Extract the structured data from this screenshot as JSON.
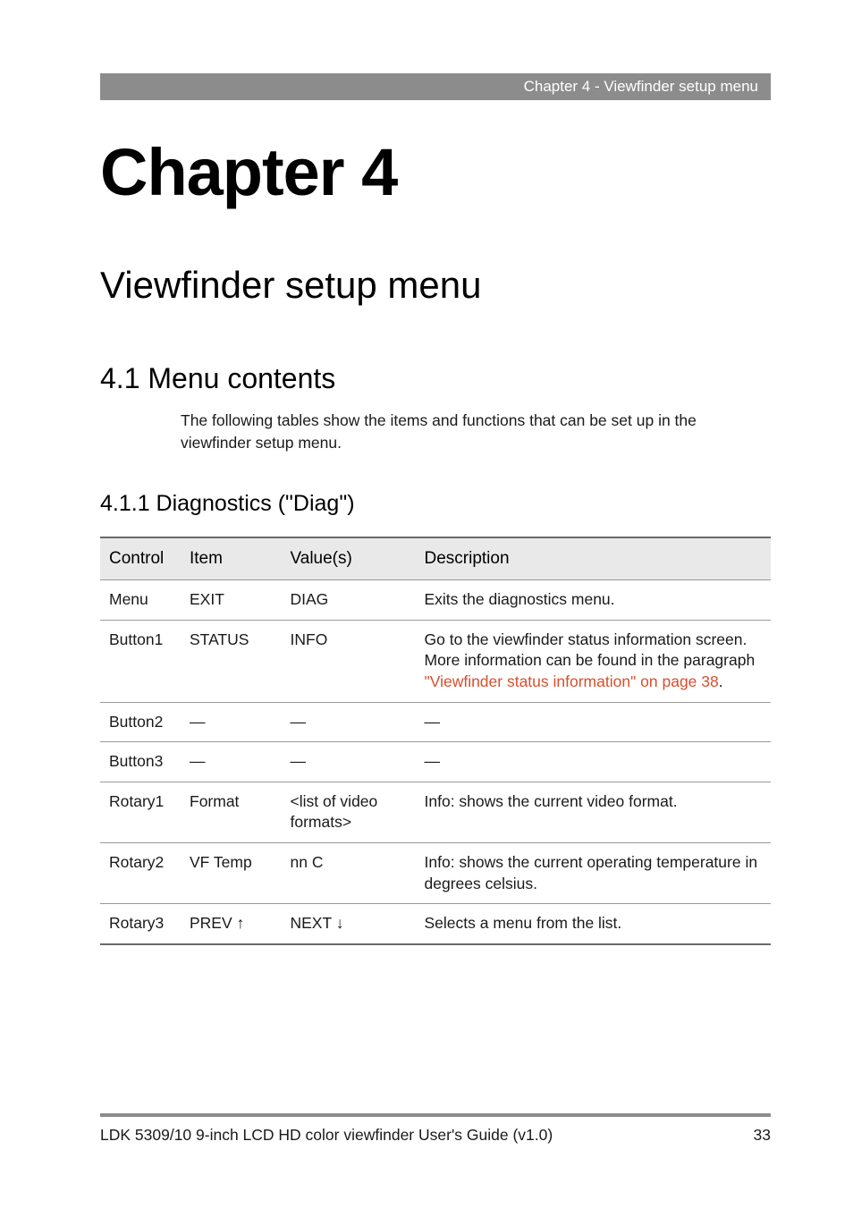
{
  "header": {
    "breadcrumb": "Chapter 4 - Viewfinder setup menu"
  },
  "titles": {
    "chapter": "Chapter 4",
    "section": "Viewfinder setup menu",
    "h2": "4.1  Menu contents",
    "h3": "4.1.1  Diagnostics (\"Diag\")"
  },
  "body": {
    "intro": "The following tables show the items and functions that can be set up in the viewfinder setup menu."
  },
  "table": {
    "headers": {
      "control": "Control",
      "item": "Item",
      "values": "Value(s)",
      "description": "Description"
    },
    "rows": [
      {
        "control": "Menu",
        "item": "EXIT",
        "values": "DIAG",
        "desc_pre": "Exits the diagnostics menu.",
        "xref": "",
        "desc_post": ""
      },
      {
        "control": "Button1",
        "item": "STATUS",
        "values": "INFO",
        "desc_pre": "Go to the viewfinder status information screen. More information can be found in the paragraph ",
        "xref": "\"Viewfinder status information\" on page 38",
        "desc_post": "."
      },
      {
        "control": "Button2",
        "item": "—",
        "values": "—",
        "desc_pre": "—",
        "xref": "",
        "desc_post": ""
      },
      {
        "control": "Button3",
        "item": "—",
        "values": "—",
        "desc_pre": "—",
        "xref": "",
        "desc_post": ""
      },
      {
        "control": "Rotary1",
        "item": "Format",
        "values": "<list of video formats>",
        "desc_pre": "Info: shows the current video format.",
        "xref": "",
        "desc_post": ""
      },
      {
        "control": "Rotary2",
        "item": "VF Temp",
        "values": "nn C",
        "desc_pre": "Info: shows the current operating temperature in degrees celsius.",
        "xref": "",
        "desc_post": ""
      },
      {
        "control": "Rotary3",
        "item": "PREV ↑",
        "values": "NEXT ↓",
        "desc_pre": "Selects a menu from the list.",
        "xref": "",
        "desc_post": ""
      }
    ]
  },
  "footer": {
    "doc": "LDK 5309/10 9-inch LCD HD color viewfinder User's Guide (v1.0)",
    "page": "33"
  }
}
